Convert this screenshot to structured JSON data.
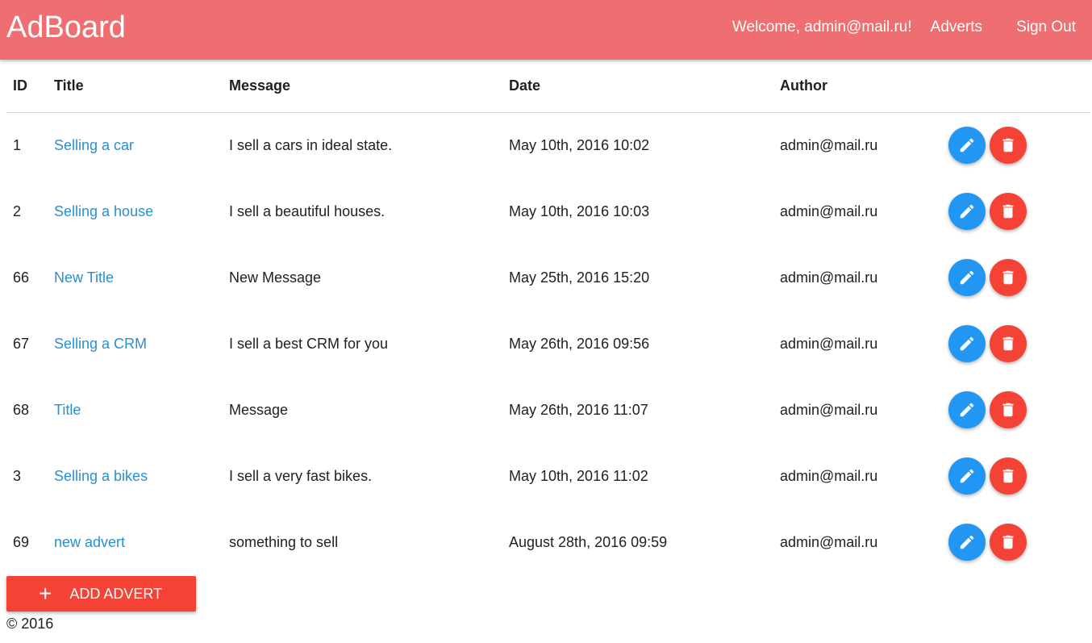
{
  "header": {
    "brand": "AdBoard",
    "welcome": "Welcome, admin@mail.ru!",
    "adverts_link": "Adverts",
    "signout_link": "Sign Out",
    "bg_color": "#ef6e72"
  },
  "table": {
    "columns": {
      "id": "ID",
      "title": "Title",
      "message": "Message",
      "date": "Date",
      "author": "Author"
    },
    "rows": [
      {
        "id": "1",
        "title": "Selling a car",
        "message": "I sell a cars in ideal state.",
        "date": "May 10th, 2016 10:02",
        "author": "admin@mail.ru"
      },
      {
        "id": "2",
        "title": "Selling a house",
        "message": "I sell a beautiful houses.",
        "date": "May 10th, 2016 10:03",
        "author": "admin@mail.ru"
      },
      {
        "id": "66",
        "title": "New Title",
        "message": "New Message",
        "date": "May 25th, 2016 15:20",
        "author": "admin@mail.ru"
      },
      {
        "id": "67",
        "title": "Selling a CRM",
        "message": "I sell a best CRM for you",
        "date": "May 26th, 2016 09:56",
        "author": "admin@mail.ru"
      },
      {
        "id": "68",
        "title": "Title",
        "message": "Message",
        "date": "May 26th, 2016 11:07",
        "author": "admin@mail.ru"
      },
      {
        "id": "3",
        "title": "Selling a bikes",
        "message": "I sell a very fast bikes.",
        "date": "May 10th, 2016 11:02",
        "author": "admin@mail.ru"
      },
      {
        "id": "69",
        "title": "new advert",
        "message": "something to sell",
        "date": "August 28th, 2016 09:59",
        "author": "admin@mail.ru"
      }
    ],
    "row_actions": {
      "edit_icon": "pencil-icon",
      "delete_icon": "trash-icon",
      "edit_color": "#2196f3",
      "delete_color": "#f44336"
    }
  },
  "add_button": {
    "icon": "plus-icon",
    "label": "ADD ADVERT",
    "color": "#f44336"
  },
  "footer": {
    "copyright": "© 2016"
  },
  "colors": {
    "link": "#2a8fd1"
  }
}
